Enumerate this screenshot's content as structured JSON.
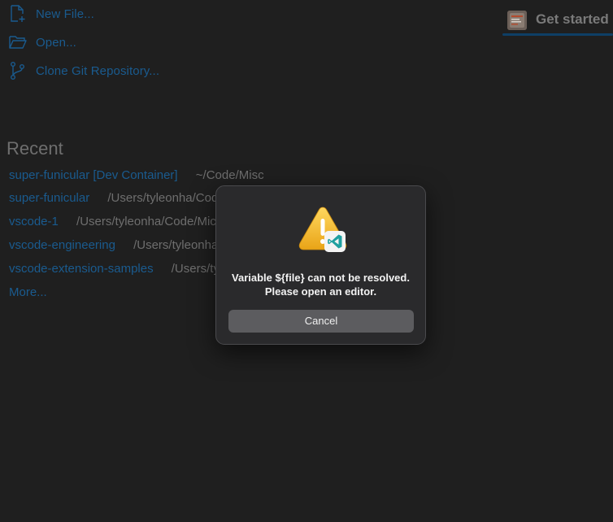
{
  "start": {
    "items": [
      {
        "label": "New File...",
        "icon": "new-file-icon"
      },
      {
        "label": "Open...",
        "icon": "folder-open-icon"
      },
      {
        "label": "Clone Git Repository...",
        "icon": "git-branch-icon"
      }
    ]
  },
  "recent": {
    "title": "Recent",
    "items": [
      {
        "name": "super-funicular [Dev Container]",
        "path": "~/Code/Misc"
      },
      {
        "name": "super-funicular",
        "path": "/Users/tyleonha/Code/Misc"
      },
      {
        "name": "vscode-1",
        "path": "/Users/tyleonha/Code/Microsoft"
      },
      {
        "name": "vscode-engineering",
        "path": "/Users/tyleonha/Code/Microsoft"
      },
      {
        "name": "vscode-extension-samples",
        "path": "/Users/tyleonha/Code/Microsoft"
      }
    ],
    "more_label": "More..."
  },
  "tab": {
    "label": "Get started",
    "icon": "get-started-tab-icon"
  },
  "dialog": {
    "message": "Variable ${file} can not be resolved. Please open an editor.",
    "cancel_label": "Cancel",
    "icon": "warning-icon",
    "badge_icon": "vscode-icon"
  },
  "colors": {
    "background": "#1f1f1f",
    "link": "#1a5b8f",
    "muted": "#6e6e6e",
    "dialog_bg": "#2a2a2c",
    "button_bg": "#5c5c5f",
    "warning": "#f5b82e",
    "vscode_badge": "#1fa0a0"
  }
}
